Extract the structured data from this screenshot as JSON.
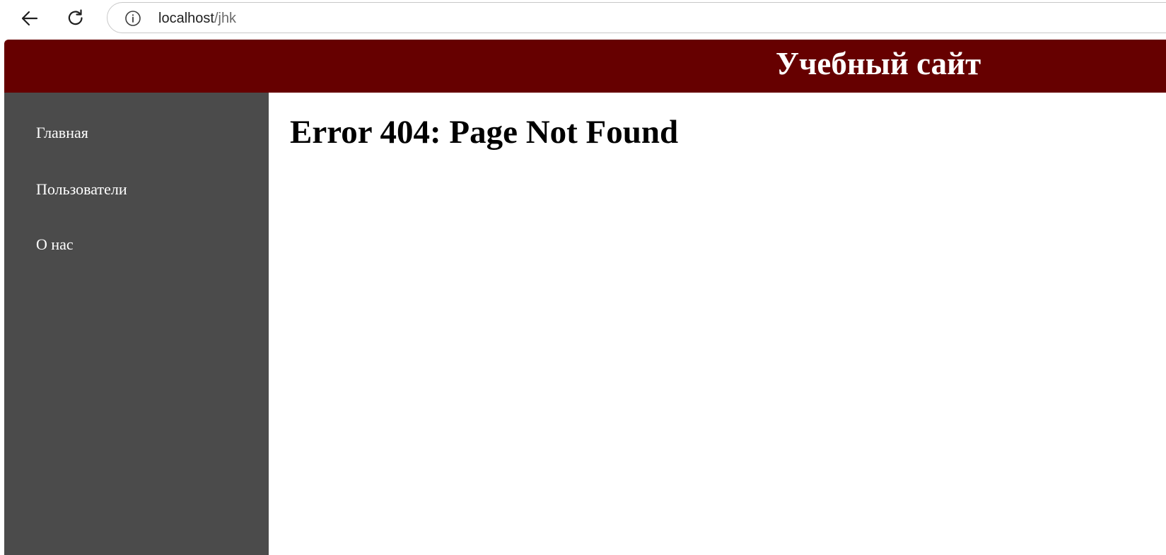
{
  "browser": {
    "url_host": "localhost",
    "url_path": "/jhk",
    "icons": {
      "back": "back-arrow-icon",
      "reload": "reload-icon",
      "site_info": "info-icon"
    }
  },
  "header": {
    "title": "Учебный сайт",
    "background_color": "#660000"
  },
  "sidebar": {
    "background_color": "#4b4b4b",
    "items": [
      {
        "label": "Главная"
      },
      {
        "label": "Пользователи"
      },
      {
        "label": "О нас"
      }
    ]
  },
  "main": {
    "heading": "Error 404: Page Not Found"
  }
}
